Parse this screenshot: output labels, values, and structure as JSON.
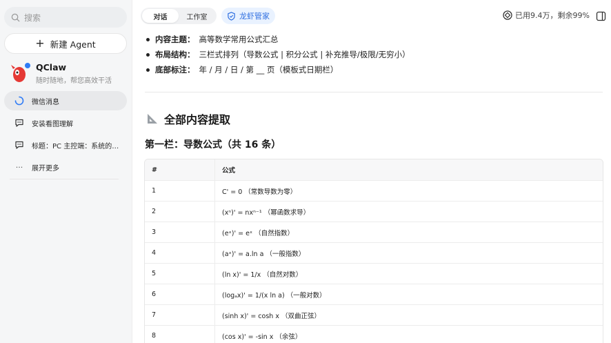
{
  "sidebar": {
    "search_placeholder": "搜索",
    "new_agent_label": "新建 Agent",
    "agent": {
      "name": "QClaw",
      "subtitle": "随时随地，帮您高效干活"
    },
    "items": [
      {
        "label": "微信消息",
        "icon": "loading-icon",
        "active": true
      },
      {
        "label": "安装看图理解",
        "icon": "chat-bubble-icon"
      },
      {
        "label": "标题：PC 主控端：系统的…",
        "icon": "chat-bubble-icon"
      },
      {
        "label": "展开更多",
        "icon": "more-dots-icon"
      }
    ]
  },
  "header": {
    "tabs": [
      "对话",
      "工作室"
    ],
    "butler_label": "龙虾管家",
    "usage_text": "已用9.4万，剩余99%"
  },
  "content": {
    "bullets": [
      {
        "key": "内容主题：",
        "value": "高等数学常用公式汇总"
      },
      {
        "key": "布局结构：",
        "value": "三栏式排列（导数公式 | 积分公式 | 补充推导/极限/无穷小）"
      },
      {
        "key": "底部标注：",
        "value": "年 / 月 / 日 / 第 __ 页（模板式日期栏）"
      }
    ],
    "section_title": "全部内容提取",
    "sub_title": "第一栏：导数公式（共 16 条）",
    "table": {
      "headers": [
        "#",
        "公式"
      ],
      "rows": [
        [
          "1",
          "C' = 0 （常数导数为零）"
        ],
        [
          "2",
          "(xⁿ)' = nxⁿ⁻¹ （幂函数求导）"
        ],
        [
          "3",
          "(eˣ)' = eˣ （自然指数）"
        ],
        [
          "4",
          "(aˣ)' = a.ln a （一般指数）"
        ],
        [
          "5",
          "(ln x)' = 1/x （自然对数）"
        ],
        [
          "6",
          "(logₐx)' = 1/(x ln a) （一般对数）"
        ],
        [
          "7",
          "(sinh x)' = cosh x （双曲正弦）"
        ],
        [
          "8",
          "(cos x)' = -sin x （余弦）"
        ]
      ]
    }
  }
}
